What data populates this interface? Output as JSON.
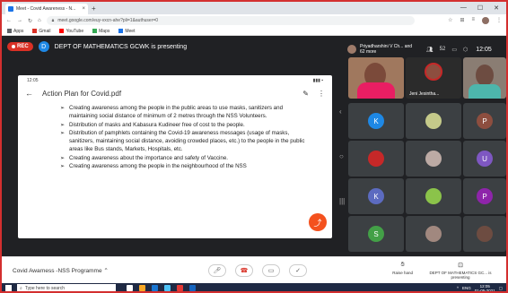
{
  "browser": {
    "tab_title": "Meet - Covid Awareness - N...",
    "tab_close": "×",
    "new_tab": "+",
    "url": "meet.google.com/euy-vxcn-ahe?pli=1&authuser=0",
    "bookmarks": [
      {
        "label": "Apps",
        "color": "#5f6368"
      },
      {
        "label": "Gmail",
        "color": "#d93025"
      },
      {
        "label": "YouTube",
        "color": "#ff0000"
      },
      {
        "label": "Maps",
        "color": "#34a853"
      },
      {
        "label": "Meet",
        "color": "#1a73e8"
      }
    ]
  },
  "meet": {
    "rec_label": "REC",
    "presenter_initial": "D",
    "presenting_text": "DEPT OF MATHEMATICS GCWK is presenting",
    "participants_text": "Priyadharshini V Ch... and 62 more",
    "participant_count": "52",
    "clock": "12:05",
    "tile_main_label": "Jeni Jesintha...",
    "tiles": [
      {
        "letter": "K",
        "color": "#1e88e5"
      },
      {
        "letter": "",
        "color": "#c5ca8a"
      },
      {
        "letter": "P",
        "color": "#8d4e3f"
      },
      {
        "letter": "",
        "color": "#c62828"
      },
      {
        "letter": "",
        "color": "#bcaaa4"
      },
      {
        "letter": "U",
        "color": "#7e57c2"
      },
      {
        "letter": "K",
        "color": "#5c6bc0"
      },
      {
        "letter": "",
        "color": "#8bc34a"
      },
      {
        "letter": "P",
        "color": "#8e24aa"
      },
      {
        "letter": "S",
        "color": "#43a047"
      },
      {
        "letter": "",
        "color": "#a1887f"
      },
      {
        "letter": "",
        "color": "#6d4c41"
      }
    ]
  },
  "phone": {
    "status_time": "12:05",
    "doc_title": "Action Plan for Covid.pdf",
    "bullets": [
      "Creating awareness among the people in the public areas to use masks, sanitizers and maintaining social distance of minimum of 2 metres through the NSS Volunteers.",
      "Distribution of masks and Kabasura Kudineer free of cost to the people.",
      "Distribution of pamphlets containing the Covid-19 awareness messages (usage of masks, sanitizers, maintaining social distance, avoiding crowded places, etc.) to the people in the public areas like Bus stands, Markets, Hospitals, etc.",
      "Creating awareness about the importance and safety of Vaccine.",
      "Creating awareness among the people in the neighbourhood of the NSS"
    ]
  },
  "bottom": {
    "meeting_name": "Covid Awarness -NSS Programme",
    "raise_hand": "Raise hand",
    "presenting_label": "DEPT OF MATHEMATICS GC... is presenting"
  },
  "taskbar": {
    "search_placeholder": "Type here to search",
    "time": "12:05",
    "date": "01-05-2021",
    "lang": "ENG"
  }
}
